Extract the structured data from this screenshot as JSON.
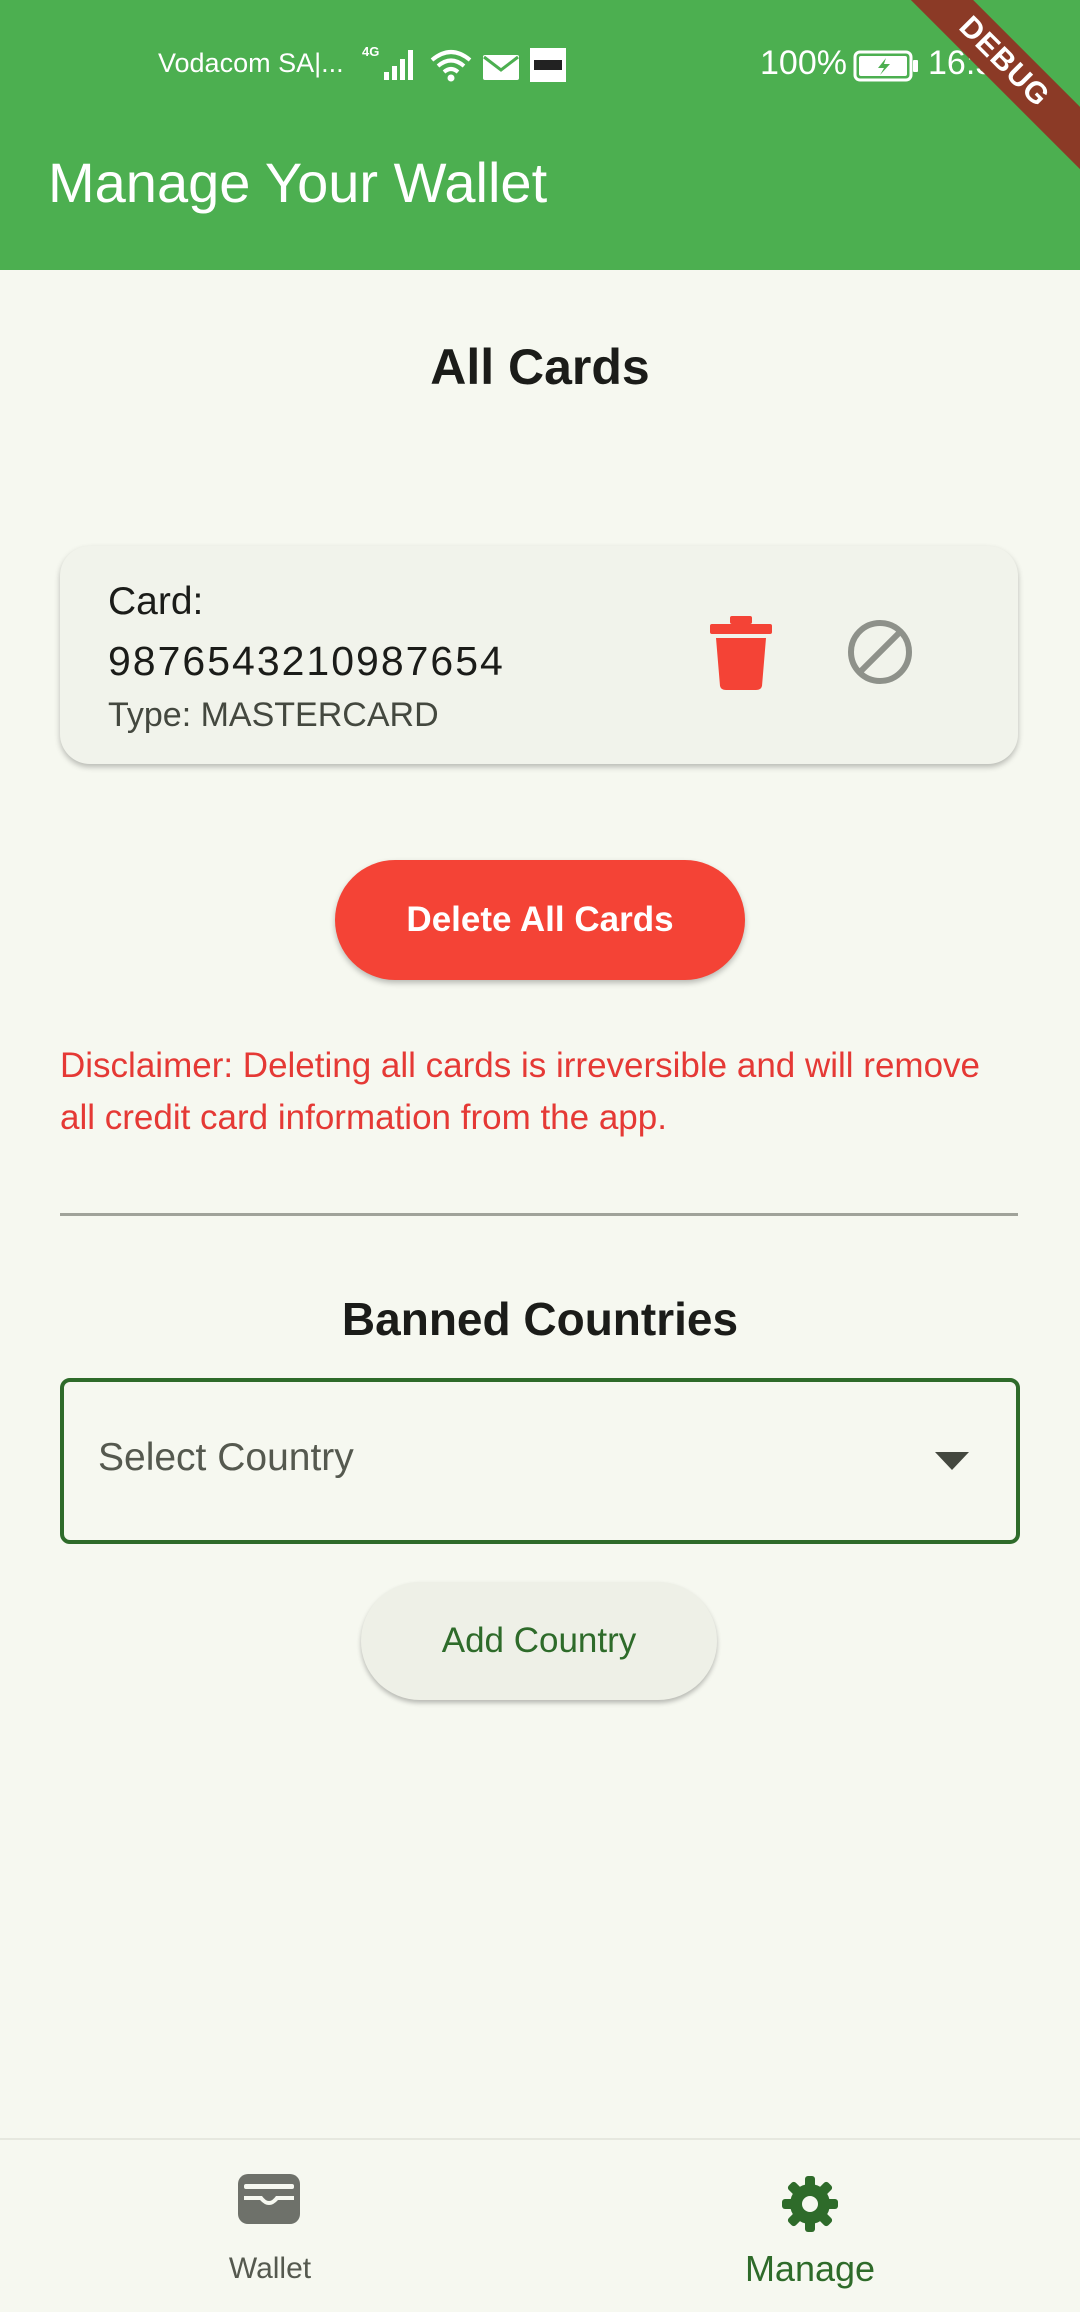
{
  "status_bar": {
    "carrier": "Vodacom SA|...",
    "network": "4G",
    "battery_percent": "100%",
    "time": "16:59",
    "icons": [
      "signal-icon",
      "wifi-icon",
      "mail-icon",
      "asap-notification-icon",
      "battery-charging-icon"
    ]
  },
  "debug_banner": "DEBUG",
  "app_bar": {
    "title": "Manage Your Wallet"
  },
  "cards_section": {
    "title": "All Cards",
    "cards": [
      {
        "label": "Card:",
        "number": "9876543210987654",
        "type": "Type: MASTERCARD",
        "actions": [
          "delete-icon",
          "block-icon"
        ]
      }
    ],
    "delete_all_label": "Delete All Cards",
    "disclaimer": "Disclaimer: Deleting all cards is irreversible and will remove all credit card information from the app."
  },
  "banned_section": {
    "title": "Banned Countries",
    "select_placeholder": "Select Country",
    "add_button_label": "Add Country"
  },
  "bottom_nav": {
    "items": [
      {
        "label": "Wallet",
        "icon": "wallet-icon",
        "active": false
      },
      {
        "label": "Manage",
        "icon": "gear-icon",
        "active": true
      }
    ]
  },
  "colors": {
    "primary": "#4caf50",
    "primary_dark": "#2e6b2a",
    "danger": "#f44336",
    "background": "#f6f8f0",
    "debug_banner": "#8b3a26"
  }
}
